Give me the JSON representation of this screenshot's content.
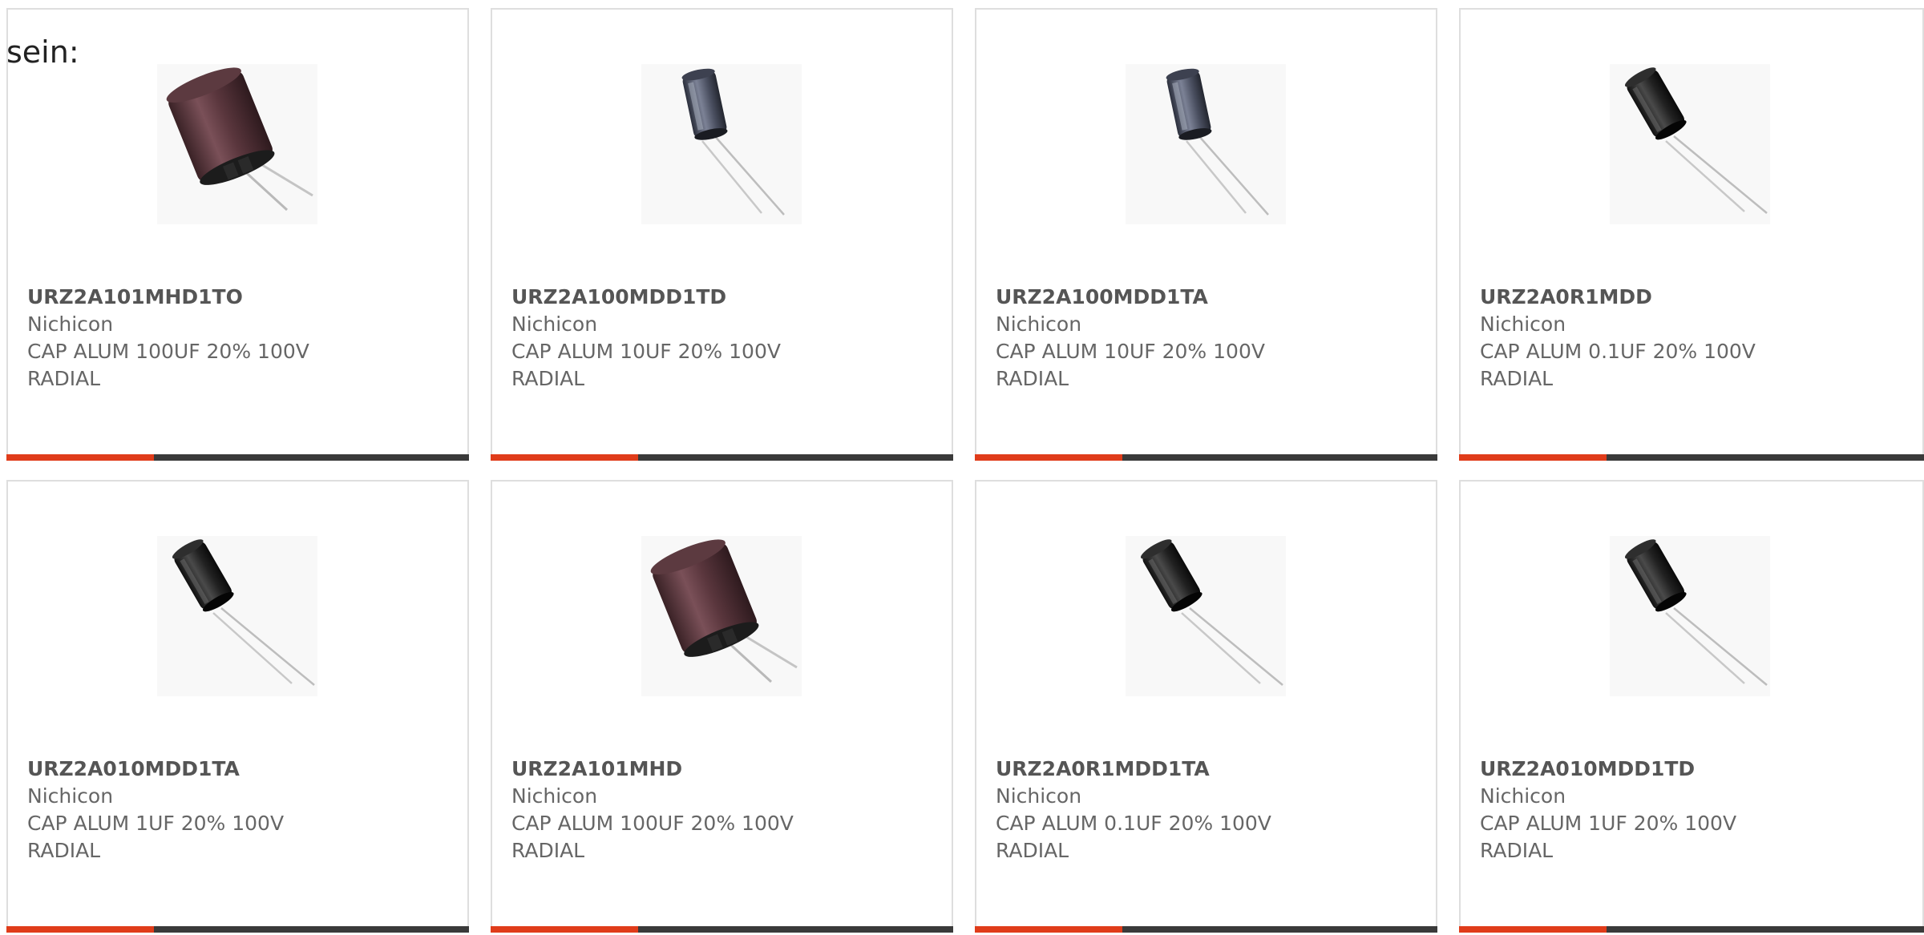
{
  "lead_text": "sein:",
  "colors": {
    "accent": "#e03c1a",
    "bar": "#3a3a3a",
    "text": "#666666"
  },
  "products": [
    {
      "part": "URZ2A101MHD1TO",
      "manufacturer": "Nichicon",
      "desc_line1": "CAP ALUM 100UF 20% 100V",
      "desc_line2": "RADIAL",
      "image": "capacitor-large-brown-icon"
    },
    {
      "part": "URZ2A100MDD1TD",
      "manufacturer": "Nichicon",
      "desc_line1": "CAP ALUM 10UF 20% 100V",
      "desc_line2": "RADIAL",
      "image": "capacitor-small-blue-icon"
    },
    {
      "part": "URZ2A100MDD1TA",
      "manufacturer": "Nichicon",
      "desc_line1": "CAP ALUM 10UF 20% 100V",
      "desc_line2": "RADIAL",
      "image": "capacitor-small-blue-icon"
    },
    {
      "part": "URZ2A0R1MDD",
      "manufacturer": "Nichicon",
      "desc_line1": "CAP ALUM 0.1UF 20% 100V",
      "desc_line2": "RADIAL",
      "image": "capacitor-small-black-icon"
    },
    {
      "part": "URZ2A010MDD1TA",
      "manufacturer": "Nichicon",
      "desc_line1": "CAP ALUM 1UF 20% 100V",
      "desc_line2": "RADIAL",
      "image": "capacitor-small-black-icon"
    },
    {
      "part": "URZ2A101MHD",
      "manufacturer": "Nichicon",
      "desc_line1": "CAP ALUM 100UF 20% 100V",
      "desc_line2": "RADIAL",
      "image": "capacitor-large-brown-icon"
    },
    {
      "part": "URZ2A0R1MDD1TA",
      "manufacturer": "Nichicon",
      "desc_line1": "CAP ALUM 0.1UF 20% 100V",
      "desc_line2": "RADIAL",
      "image": "capacitor-small-black-icon"
    },
    {
      "part": "URZ2A010MDD1TD",
      "manufacturer": "Nichicon",
      "desc_line1": "CAP ALUM 1UF 20% 100V",
      "desc_line2": "RADIAL",
      "image": "capacitor-small-black-icon"
    }
  ]
}
